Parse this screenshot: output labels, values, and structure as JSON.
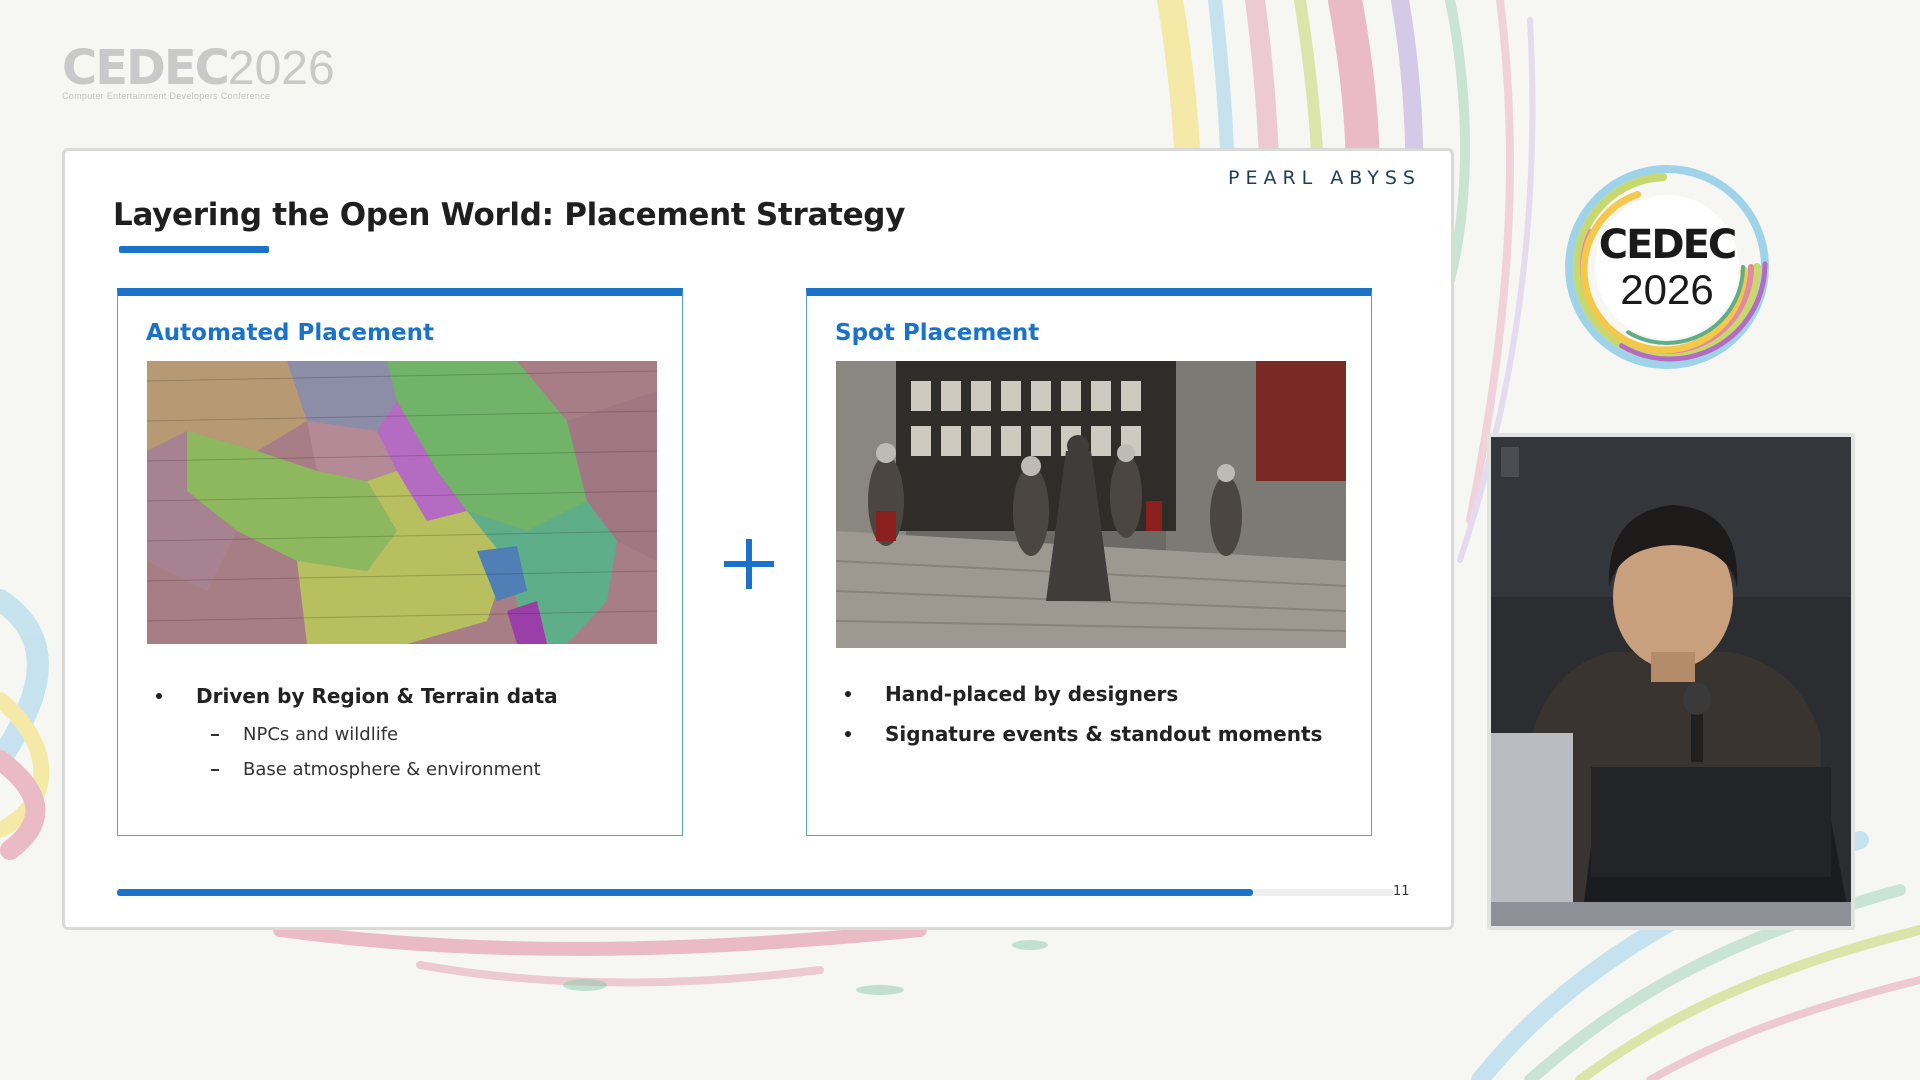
{
  "conference": {
    "logo_word": "CEDEC",
    "logo_year": "2026",
    "logo_subtitle": "Computer Entertainment Developers Conference",
    "badge_word": "CEDEC",
    "badge_year": "2026"
  },
  "slide": {
    "brand": "PEARL ABYSS",
    "title": "Layering the Open World: Placement Strategy",
    "page_number": "11",
    "progress_fraction": 0.89,
    "accent_color": "#1a73c8",
    "left_card": {
      "title": "Automated Placement",
      "image_icon": "region-terrain-map-image",
      "bullets": [
        {
          "text": "Driven by Region & Terrain data",
          "sub": [
            "NPCs and wildlife",
            "Base atmosphere & environment"
          ]
        }
      ]
    },
    "right_card": {
      "title": "Spot Placement",
      "image_icon": "knights-at-gate-scene-image",
      "bullets": [
        {
          "text": "Hand-placed by designers"
        },
        {
          "text": "Signature events & standout moments"
        }
      ]
    },
    "connector_icon": "plus-icon"
  },
  "speaker_video": {
    "icon": "speaker-camera-feed"
  }
}
